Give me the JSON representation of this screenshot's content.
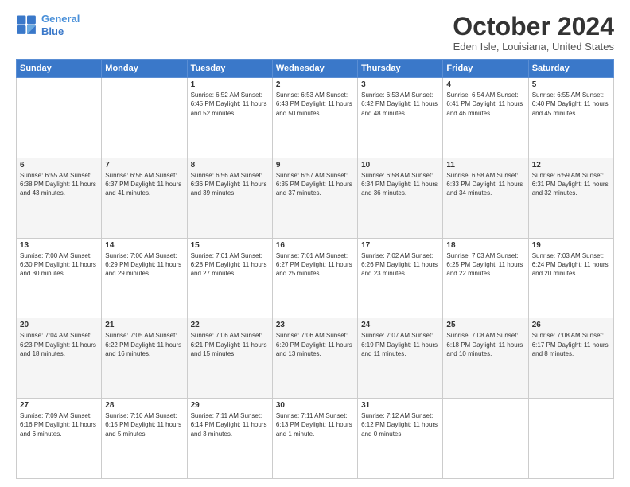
{
  "logo": {
    "line1": "General",
    "line2": "Blue"
  },
  "title": "October 2024",
  "location": "Eden Isle, Louisiana, United States",
  "days_of_week": [
    "Sunday",
    "Monday",
    "Tuesday",
    "Wednesday",
    "Thursday",
    "Friday",
    "Saturday"
  ],
  "weeks": [
    [
      {
        "day": "",
        "info": ""
      },
      {
        "day": "",
        "info": ""
      },
      {
        "day": "1",
        "info": "Sunrise: 6:52 AM\nSunset: 6:45 PM\nDaylight: 11 hours and 52 minutes."
      },
      {
        "day": "2",
        "info": "Sunrise: 6:53 AM\nSunset: 6:43 PM\nDaylight: 11 hours and 50 minutes."
      },
      {
        "day": "3",
        "info": "Sunrise: 6:53 AM\nSunset: 6:42 PM\nDaylight: 11 hours and 48 minutes."
      },
      {
        "day": "4",
        "info": "Sunrise: 6:54 AM\nSunset: 6:41 PM\nDaylight: 11 hours and 46 minutes."
      },
      {
        "day": "5",
        "info": "Sunrise: 6:55 AM\nSunset: 6:40 PM\nDaylight: 11 hours and 45 minutes."
      }
    ],
    [
      {
        "day": "6",
        "info": "Sunrise: 6:55 AM\nSunset: 6:38 PM\nDaylight: 11 hours and 43 minutes."
      },
      {
        "day": "7",
        "info": "Sunrise: 6:56 AM\nSunset: 6:37 PM\nDaylight: 11 hours and 41 minutes."
      },
      {
        "day": "8",
        "info": "Sunrise: 6:56 AM\nSunset: 6:36 PM\nDaylight: 11 hours and 39 minutes."
      },
      {
        "day": "9",
        "info": "Sunrise: 6:57 AM\nSunset: 6:35 PM\nDaylight: 11 hours and 37 minutes."
      },
      {
        "day": "10",
        "info": "Sunrise: 6:58 AM\nSunset: 6:34 PM\nDaylight: 11 hours and 36 minutes."
      },
      {
        "day": "11",
        "info": "Sunrise: 6:58 AM\nSunset: 6:33 PM\nDaylight: 11 hours and 34 minutes."
      },
      {
        "day": "12",
        "info": "Sunrise: 6:59 AM\nSunset: 6:31 PM\nDaylight: 11 hours and 32 minutes."
      }
    ],
    [
      {
        "day": "13",
        "info": "Sunrise: 7:00 AM\nSunset: 6:30 PM\nDaylight: 11 hours and 30 minutes."
      },
      {
        "day": "14",
        "info": "Sunrise: 7:00 AM\nSunset: 6:29 PM\nDaylight: 11 hours and 29 minutes."
      },
      {
        "day": "15",
        "info": "Sunrise: 7:01 AM\nSunset: 6:28 PM\nDaylight: 11 hours and 27 minutes."
      },
      {
        "day": "16",
        "info": "Sunrise: 7:01 AM\nSunset: 6:27 PM\nDaylight: 11 hours and 25 minutes."
      },
      {
        "day": "17",
        "info": "Sunrise: 7:02 AM\nSunset: 6:26 PM\nDaylight: 11 hours and 23 minutes."
      },
      {
        "day": "18",
        "info": "Sunrise: 7:03 AM\nSunset: 6:25 PM\nDaylight: 11 hours and 22 minutes."
      },
      {
        "day": "19",
        "info": "Sunrise: 7:03 AM\nSunset: 6:24 PM\nDaylight: 11 hours and 20 minutes."
      }
    ],
    [
      {
        "day": "20",
        "info": "Sunrise: 7:04 AM\nSunset: 6:23 PM\nDaylight: 11 hours and 18 minutes."
      },
      {
        "day": "21",
        "info": "Sunrise: 7:05 AM\nSunset: 6:22 PM\nDaylight: 11 hours and 16 minutes."
      },
      {
        "day": "22",
        "info": "Sunrise: 7:06 AM\nSunset: 6:21 PM\nDaylight: 11 hours and 15 minutes."
      },
      {
        "day": "23",
        "info": "Sunrise: 7:06 AM\nSunset: 6:20 PM\nDaylight: 11 hours and 13 minutes."
      },
      {
        "day": "24",
        "info": "Sunrise: 7:07 AM\nSunset: 6:19 PM\nDaylight: 11 hours and 11 minutes."
      },
      {
        "day": "25",
        "info": "Sunrise: 7:08 AM\nSunset: 6:18 PM\nDaylight: 11 hours and 10 minutes."
      },
      {
        "day": "26",
        "info": "Sunrise: 7:08 AM\nSunset: 6:17 PM\nDaylight: 11 hours and 8 minutes."
      }
    ],
    [
      {
        "day": "27",
        "info": "Sunrise: 7:09 AM\nSunset: 6:16 PM\nDaylight: 11 hours and 6 minutes."
      },
      {
        "day": "28",
        "info": "Sunrise: 7:10 AM\nSunset: 6:15 PM\nDaylight: 11 hours and 5 minutes."
      },
      {
        "day": "29",
        "info": "Sunrise: 7:11 AM\nSunset: 6:14 PM\nDaylight: 11 hours and 3 minutes."
      },
      {
        "day": "30",
        "info": "Sunrise: 7:11 AM\nSunset: 6:13 PM\nDaylight: 11 hours and 1 minute."
      },
      {
        "day": "31",
        "info": "Sunrise: 7:12 AM\nSunset: 6:12 PM\nDaylight: 11 hours and 0 minutes."
      },
      {
        "day": "",
        "info": ""
      },
      {
        "day": "",
        "info": ""
      }
    ]
  ]
}
